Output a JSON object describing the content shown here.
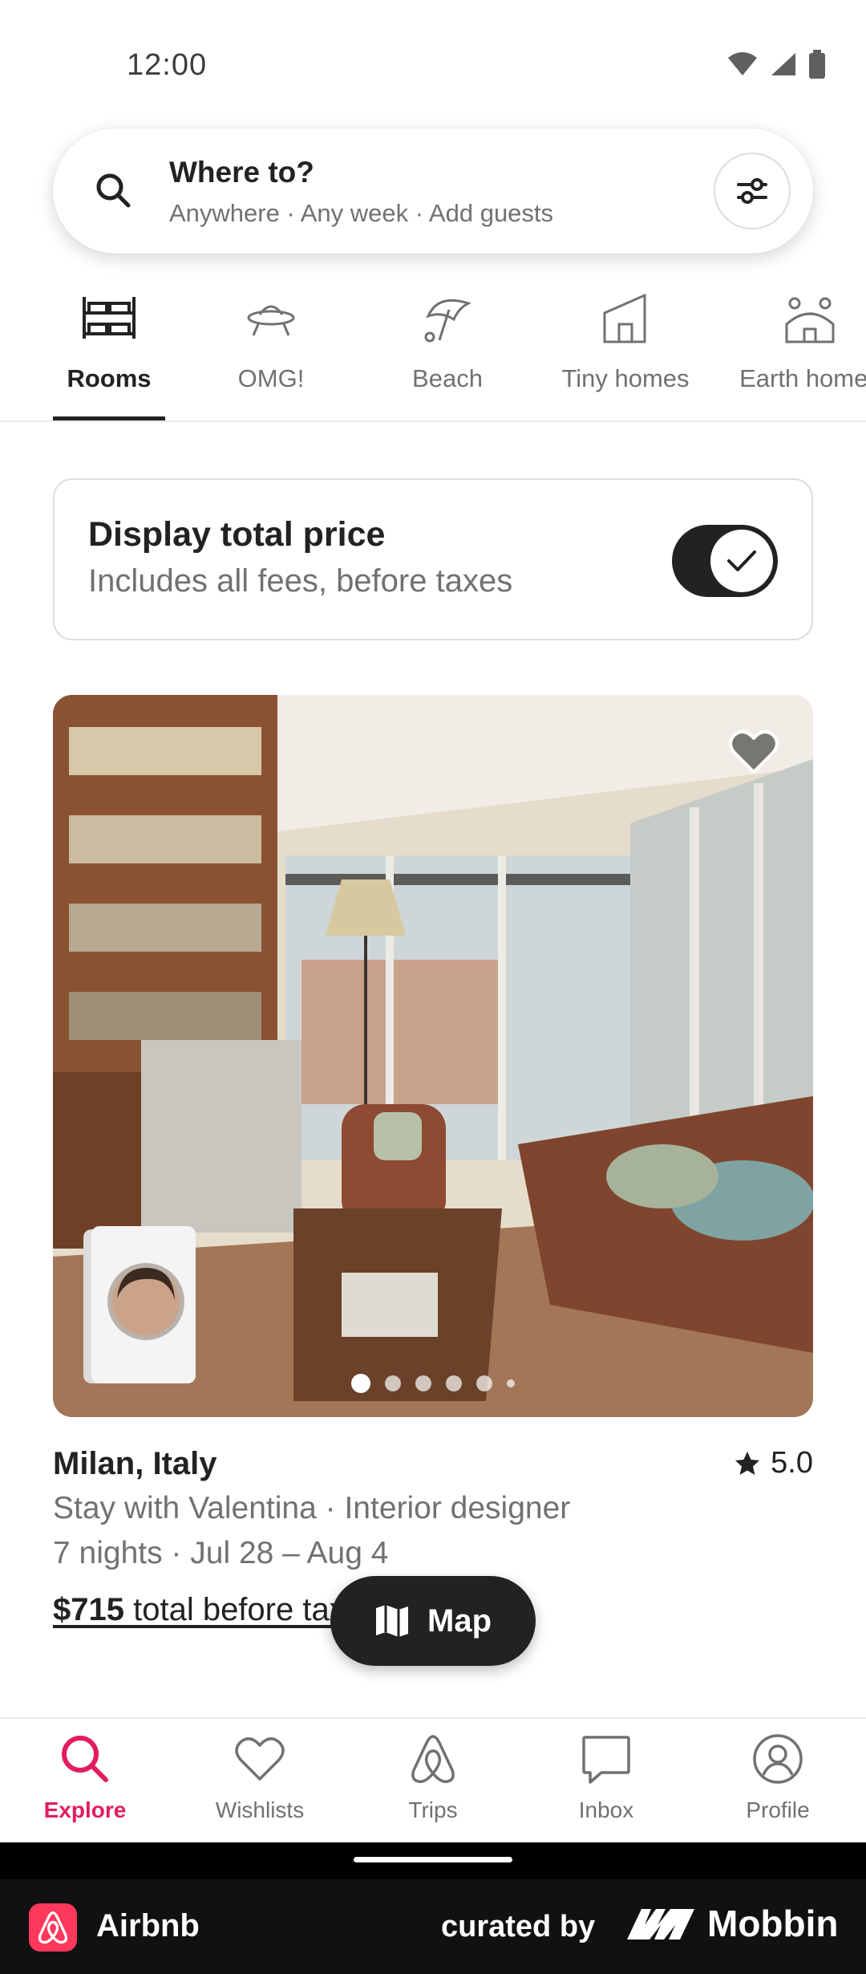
{
  "status_bar": {
    "time": "12:00"
  },
  "search": {
    "title": "Where to?",
    "subtitle": "Anywhere · Any week · Add guests"
  },
  "categories": [
    {
      "label": "Rooms",
      "icon": "bunk-bed-icon",
      "active": true
    },
    {
      "label": "OMG!",
      "icon": "ufo-icon",
      "active": false
    },
    {
      "label": "Beach",
      "icon": "beach-umbrella-icon",
      "active": false
    },
    {
      "label": "Tiny homes",
      "icon": "tiny-home-icon",
      "active": false
    },
    {
      "label": "Earth homes",
      "icon": "earth-home-icon",
      "active": false
    }
  ],
  "price_toggle": {
    "title": "Display total price",
    "subtitle": "Includes all fees, before taxes",
    "enabled": true
  },
  "listing": {
    "location": "Milan, Italy",
    "rating": "5.0",
    "host": "Stay with Valentina · Interior designer",
    "dates": "7 nights · Jul 28 – Aug 4",
    "price": "$715",
    "price_suffix": " total before taxes",
    "photo_count": 6,
    "photo_index": 1
  },
  "map_button": {
    "label": "Map"
  },
  "bottom_nav": [
    {
      "label": "Explore",
      "icon": "search-icon",
      "active": true
    },
    {
      "label": "Wishlists",
      "icon": "heart-icon",
      "active": false
    },
    {
      "label": "Trips",
      "icon": "airbnb-logo-icon",
      "active": false
    },
    {
      "label": "Inbox",
      "icon": "message-icon",
      "active": false
    },
    {
      "label": "Profile",
      "icon": "user-circle-icon",
      "active": false
    }
  ],
  "footer": {
    "app_name": "Airbnb",
    "curated_by": "curated by",
    "brand": "Mobbin"
  },
  "colors": {
    "accent": "#e31c5f",
    "text": "#222222",
    "muted": "#717171"
  }
}
